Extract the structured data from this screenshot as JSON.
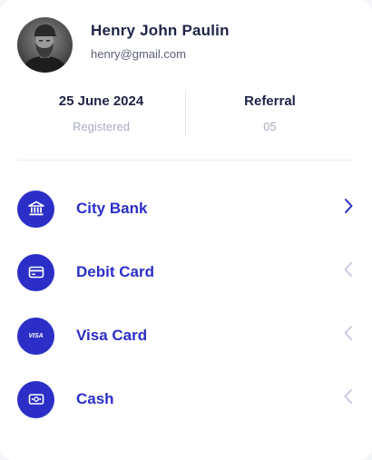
{
  "profile": {
    "name": "Henry John Paulin",
    "email": "henry@gmail.com",
    "avatar_icon": "avatar-photo"
  },
  "stats": [
    {
      "value": "25 June 2024",
      "label": "Registered"
    },
    {
      "value": "Referral",
      "label": "05"
    }
  ],
  "methods": [
    {
      "label": "City Bank",
      "icon": "bank-icon",
      "chevron": "chevron-right-icon",
      "active": true
    },
    {
      "label": "Debit Card",
      "icon": "card-icon",
      "chevron": "chevron-left-icon",
      "active": false
    },
    {
      "label": "Visa Card",
      "icon": "visa-icon",
      "icon_text": "VISA",
      "chevron": "chevron-left-icon",
      "active": false
    },
    {
      "label": "Cash",
      "icon": "cash-icon",
      "chevron": "chevron-left-icon",
      "active": false
    }
  ],
  "colors": {
    "accent": "#2b2fc7",
    "title": "#1f2447",
    "muted": "#a9adbf",
    "chevron_inactive": "#c9cbe0"
  }
}
